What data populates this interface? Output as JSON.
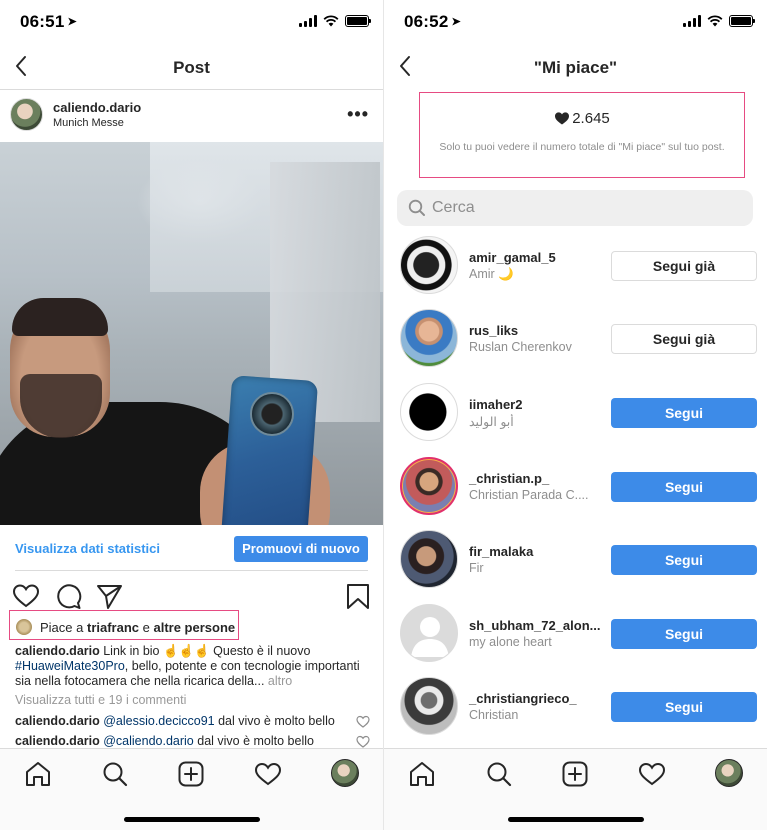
{
  "left": {
    "status": {
      "time": "06:51"
    },
    "header": {
      "title": "Post"
    },
    "post": {
      "username": "caliendo.dario",
      "location": "Munich Messe",
      "stats_link": "Visualizza dati statistici",
      "promote_button": "Promuovi di nuovo",
      "likes_prefix": "Piace a ",
      "likes_user": "triafranc",
      "likes_mid": " e ",
      "likes_others": "altre persone",
      "caption_user": "caliendo.dario",
      "caption_text_1": " Link in bio ☝️☝️☝️ Questo è il nuovo ",
      "caption_hashtag": "#HuaweiMate30Pro",
      "caption_text_2": ", bello, potente e con tecnologie importanti sia nella fotocamera che nella ricarica della... ",
      "caption_more": "altro",
      "view_all_comments": "Visualizza tutti e 19 i commenti",
      "comments": [
        {
          "user": "caliendo.dario",
          "mention": "@alessio.decicco91",
          "text": " dal vivo è molto bello"
        },
        {
          "user": "caliendo.dario",
          "mention": "@caliendo.dario",
          "text": " dal vivo è molto bello"
        }
      ]
    }
  },
  "right": {
    "status": {
      "time": "06:52"
    },
    "header": {
      "title": "\"Mi piace\""
    },
    "summary": {
      "count": "2.645",
      "note": "Solo tu puoi vedere il numero totale di \"Mi piace\" sul tuo post."
    },
    "search": {
      "placeholder": "Cerca"
    },
    "users": [
      {
        "username": "amir_gamal_5",
        "fullname": "Amir 🌙",
        "button": "Segui già",
        "state": "following"
      },
      {
        "username": "rus_liks",
        "fullname": "Ruslan Cherenkov",
        "button": "Segui già",
        "state": "following"
      },
      {
        "username": "iimaher2",
        "fullname": "أبو الوليد",
        "button": "Segui",
        "state": "follow"
      },
      {
        "username": "_christian.p_",
        "fullname": "Christian Parada C....",
        "button": "Segui",
        "state": "follow"
      },
      {
        "username": "fir_malaka",
        "fullname": "Fir",
        "button": "Segui",
        "state": "follow"
      },
      {
        "username": "sh_ubham_72_alon...",
        "fullname": "my alone heart",
        "button": "Segui",
        "state": "follow"
      },
      {
        "username": "_christiangrieco_",
        "fullname": "Christian",
        "button": "Segui",
        "state": "follow"
      }
    ]
  },
  "colors": {
    "accent": "#3d8be8",
    "highlight": "#e64b82",
    "link": "#3897f0"
  }
}
